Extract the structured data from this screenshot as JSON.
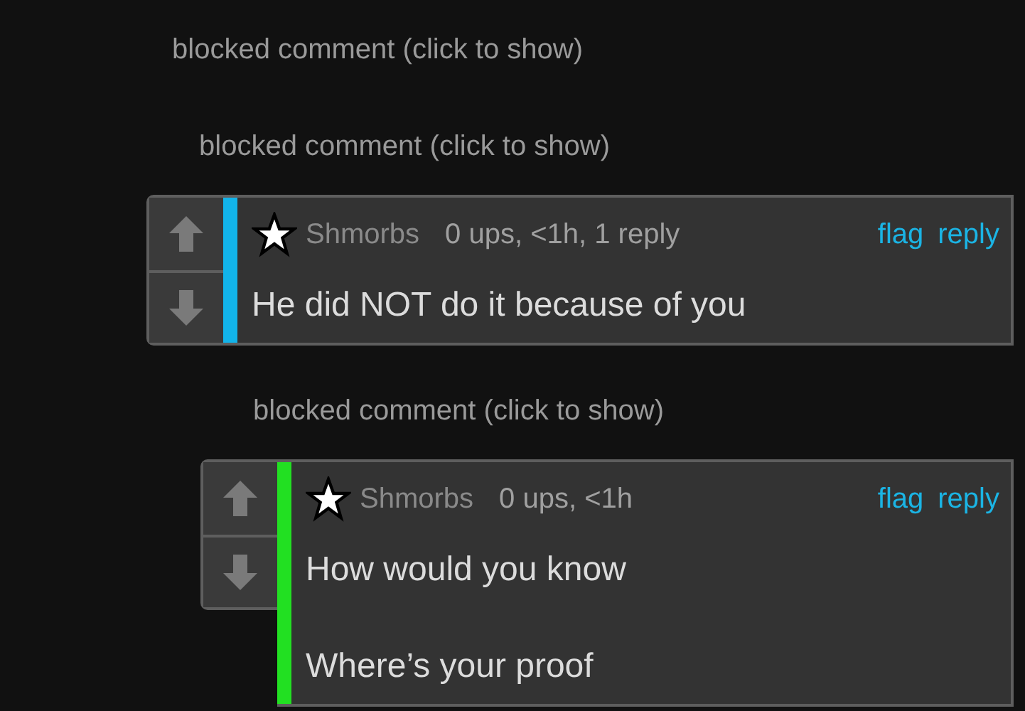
{
  "thread": [
    {
      "kind": "blocked",
      "text": "blocked comment (click to show)",
      "children": [
        {
          "kind": "blocked",
          "text": "blocked comment (click to show)",
          "children": [
            {
              "kind": "comment",
              "color": "#12b4ea",
              "username": "Shmorbs",
              "meta": "0 ups, <1h, 1 reply",
              "actions": [
                "flag",
                "reply"
              ],
              "body": [
                "He did NOT do it because of you"
              ],
              "children": [
                {
                  "kind": "blocked",
                  "text": "blocked comment (click to show)",
                  "children": [
                    {
                      "kind": "comment",
                      "color": "#22e022",
                      "username": "Shmorbs",
                      "meta": "0 ups, <1h",
                      "actions": [
                        "flag",
                        "reply"
                      ],
                      "body": [
                        "How would you know",
                        "Where’s your proof"
                      ]
                    }
                  ]
                }
              ]
            }
          ]
        }
      ]
    }
  ]
}
